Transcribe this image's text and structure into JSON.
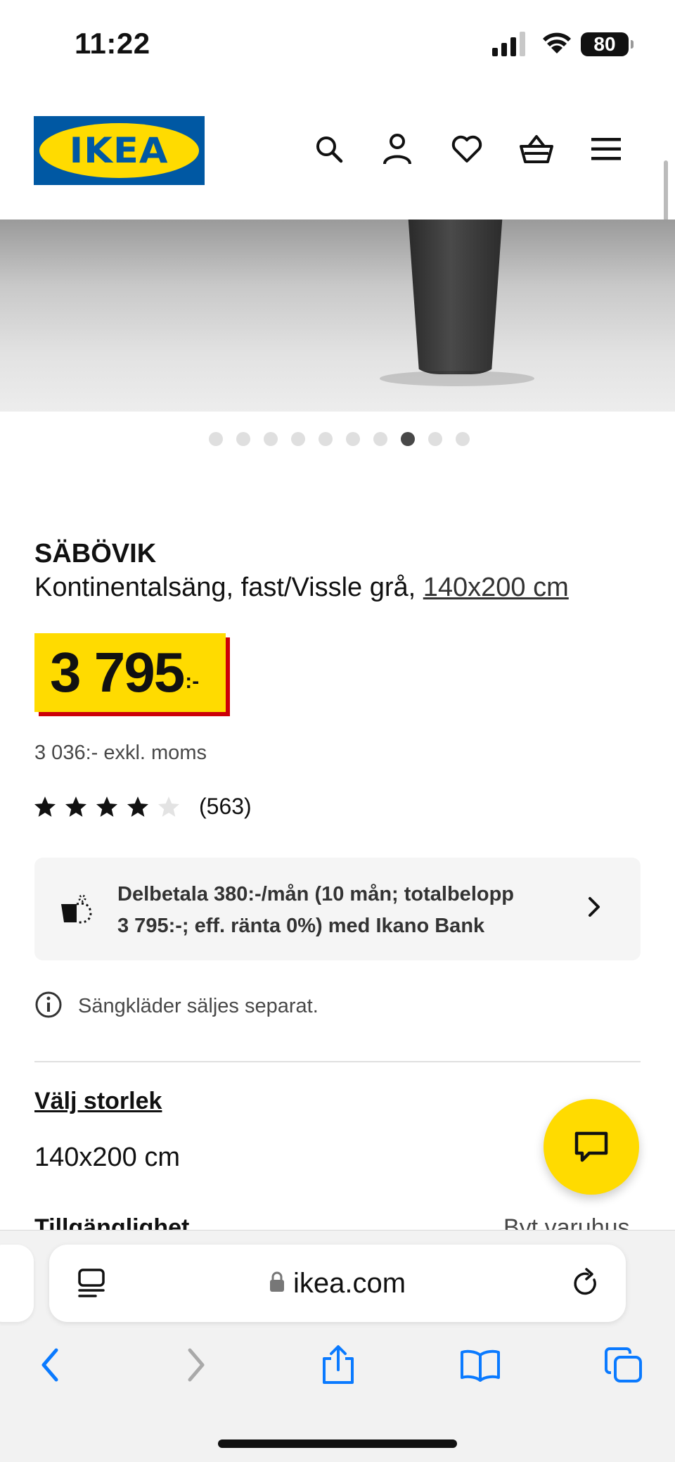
{
  "status_bar": {
    "time": "11:22",
    "battery": "80"
  },
  "header": {
    "logo_text": "IKEA",
    "icons": [
      "search-icon",
      "account-icon",
      "heart-icon",
      "basket-icon",
      "menu-icon"
    ]
  },
  "gallery": {
    "dot_count": 10,
    "active_index": 7
  },
  "product": {
    "name": "SÄBÖVIK",
    "description": "Kontinentalsäng, fast/Vissle grå, ",
    "size_link": "140x200 cm",
    "price": "3 795",
    "price_suffix": ":-",
    "price_ex_vat": "3 036:- exkl. moms",
    "rating_stars": 4,
    "rating_max": 5,
    "review_count": "(563)"
  },
  "finance": {
    "line1": "Delbetala 380:-/mån (10 mån; totalbelopp",
    "line2": "3 795:-; eff. ränta 0%) med Ikano Bank"
  },
  "note": {
    "text": "Sängkläder säljes separat."
  },
  "size_selector": {
    "heading": "Välj storlek",
    "value": "140x200 cm"
  },
  "availability": {
    "label": "Tillgänglighet",
    "link": "Byt varuhus"
  },
  "browser": {
    "url": "ikea.com"
  },
  "colors": {
    "ikea_blue": "#0058a3",
    "ikea_yellow": "#ffdb00",
    "price_red": "#cc0008",
    "safari_blue": "#0a7aff"
  }
}
